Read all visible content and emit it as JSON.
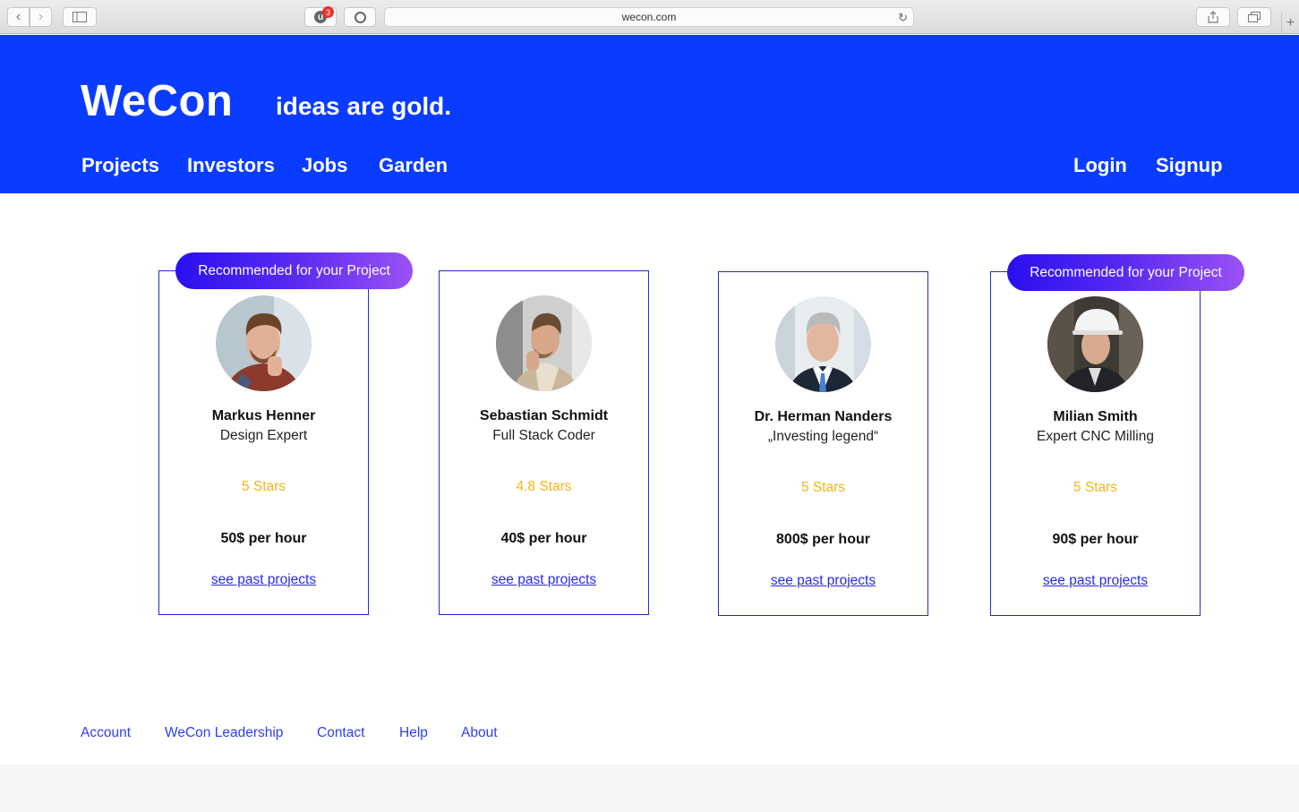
{
  "browser": {
    "url": "wecon.com",
    "extension_badge": "3",
    "extension_letter": "u"
  },
  "brand": {
    "name": "WeCon",
    "tagline": "ideas are gold."
  },
  "nav": {
    "items": [
      "Projects",
      "Investors",
      "Jobs",
      "Garden"
    ],
    "login": "Login",
    "signup": "Signup"
  },
  "ribbon_label": "Recommended for your Project",
  "cards": [
    {
      "name": "Markus Henner",
      "role": "Design Expert",
      "stars": "5 Stars",
      "rate": "50$ per hour",
      "link": "see past projects",
      "recommended": true
    },
    {
      "name": "Sebastian Schmidt",
      "role": "Full Stack Coder",
      "stars": "4.8 Stars",
      "rate": "40$ per hour",
      "link": "see past projects",
      "recommended": false
    },
    {
      "name": "Dr. Herman Nanders",
      "role": "„Investing legend“",
      "stars": "5 Stars",
      "rate": "800$ per hour",
      "link": "see past projects",
      "recommended": false
    },
    {
      "name": "Milian Smith",
      "role": "Expert CNC Milling",
      "stars": "5 Stars",
      "rate": "90$ per hour",
      "link": "see past projects",
      "recommended": true
    }
  ],
  "footer": {
    "links": [
      "Account",
      "WeCon Leadership",
      "Contact",
      "Help",
      "About"
    ]
  },
  "colors": {
    "brand_blue": "#0a3cff",
    "card_border": "#1f2bcc",
    "stars": "#f2b418",
    "link": "#2a2ae8",
    "ribbon_start": "#2a10f0",
    "ribbon_end": "#9a52f5"
  }
}
